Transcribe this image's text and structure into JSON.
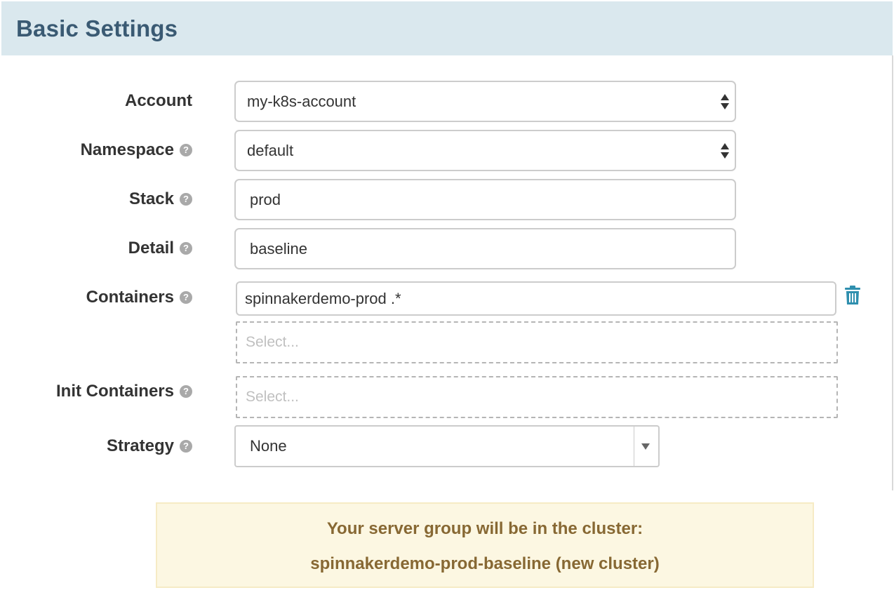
{
  "header": {
    "title": "Basic Settings"
  },
  "form": {
    "account": {
      "label": "Account",
      "value": "my-k8s-account"
    },
    "namespace": {
      "label": "Namespace",
      "value": "default"
    },
    "stack": {
      "label": "Stack",
      "value": "prod"
    },
    "detail": {
      "label": "Detail",
      "value": "baseline"
    },
    "containers": {
      "label": "Containers",
      "value": "spinnakerdemo-prod .*",
      "select_placeholder": "Select..."
    },
    "init_containers": {
      "label": "Init Containers",
      "placeholder": "Select..."
    },
    "strategy": {
      "label": "Strategy",
      "value": "None"
    }
  },
  "help_icon_glyph": "?",
  "notice": {
    "line1": "Your server group will be in the cluster:",
    "line2": "spinnakerdemo-prod-baseline (new cluster)"
  },
  "colors": {
    "header_bg": "#dae8ee",
    "header_text": "#3a5a73",
    "notice_bg": "#fcf7e2",
    "notice_text": "#876833",
    "trash_icon": "#2f8fae"
  }
}
